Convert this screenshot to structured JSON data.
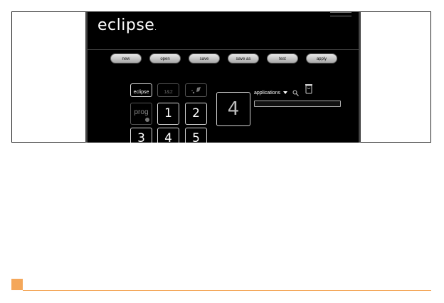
{
  "app": {
    "logo_text": "eclipse",
    "logo_dot": "."
  },
  "toolbar": {
    "buttons": [
      "new",
      "open",
      "save",
      "save as",
      "test",
      "apply"
    ]
  },
  "keypad": {
    "eclipse_key": "eclipse",
    "key_mini_label": "1&2",
    "prog_label": "prog",
    "keys": [
      "1",
      "2",
      "3",
      "4",
      "5"
    ],
    "large_key": "4"
  },
  "applications": {
    "label": "applications"
  },
  "icons": {
    "search": "magnifier-icon",
    "trash": "trash-icon",
    "paint": "paint-icon"
  },
  "colors": {
    "accent": "#f4a75a",
    "app_bg": "#000000"
  }
}
